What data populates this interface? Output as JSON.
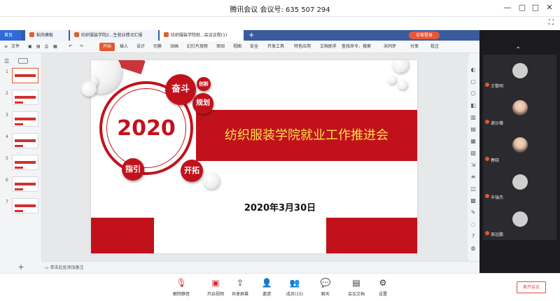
{
  "window": {
    "title": "腾讯会议 会议号: 635 507 294",
    "controls": [
      "—",
      "▢",
      "□",
      "✕"
    ]
  },
  "wps": {
    "tabs": [
      "首页",
      "稻壳模板",
      "纺织服装学院2...生就业情况汇报",
      "纺织服装学院就...会议议程(1)"
    ],
    "login_label": "访客登录",
    "ribbon_items": [
      "文件",
      "开始",
      "插入",
      "设计",
      "切换",
      "动画",
      "幻灯片放映",
      "审阅",
      "视图",
      "安全",
      "开发工具",
      "特色应用",
      "文档助手"
    ],
    "ribbon_right": [
      "查找命令、搜索",
      "未同步",
      "分享",
      "批注"
    ],
    "slide_numbers": [
      "1",
      "2",
      "3",
      "4",
      "5",
      "6",
      "7"
    ],
    "notes_placeholder": "单击此处添加备注",
    "add_slide": "+"
  },
  "slide": {
    "year": "2020",
    "title": "纺织服装学院就业工作推进会",
    "date": "2020年3月30日",
    "badges": {
      "fendou": "奋斗",
      "chuangxin": "创新",
      "guihua": "规划",
      "zhiyin": "指引",
      "kaituo": "开拓"
    },
    "accent_color": "#c1121b",
    "title_color": "#f6e04a"
  },
  "participants": [
    {
      "name": "王黎明",
      "avatar": "default"
    },
    {
      "name": "谢沙薇",
      "avatar": "photo"
    },
    {
      "name": "春晓",
      "avatar": "photo"
    },
    {
      "name": "辛瑞杰",
      "avatar": "default"
    },
    {
      "name": "周远鹏",
      "avatar": "default"
    }
  ],
  "bottom_toolbar": [
    {
      "label": "解除静音",
      "icon": "mic-muted-icon"
    },
    {
      "label": "开启视频",
      "icon": "video-off-icon"
    },
    {
      "label": "共享屏幕",
      "icon": "share-screen-icon"
    },
    {
      "label": "邀请",
      "icon": "invite-icon"
    },
    {
      "label": "成员(15)",
      "icon": "members-icon"
    },
    {
      "label": "聊天",
      "icon": "chat-icon"
    },
    {
      "label": "会议文档",
      "icon": "document-icon"
    },
    {
      "label": "设置",
      "icon": "settings-icon"
    }
  ],
  "end_button": "离开会议"
}
